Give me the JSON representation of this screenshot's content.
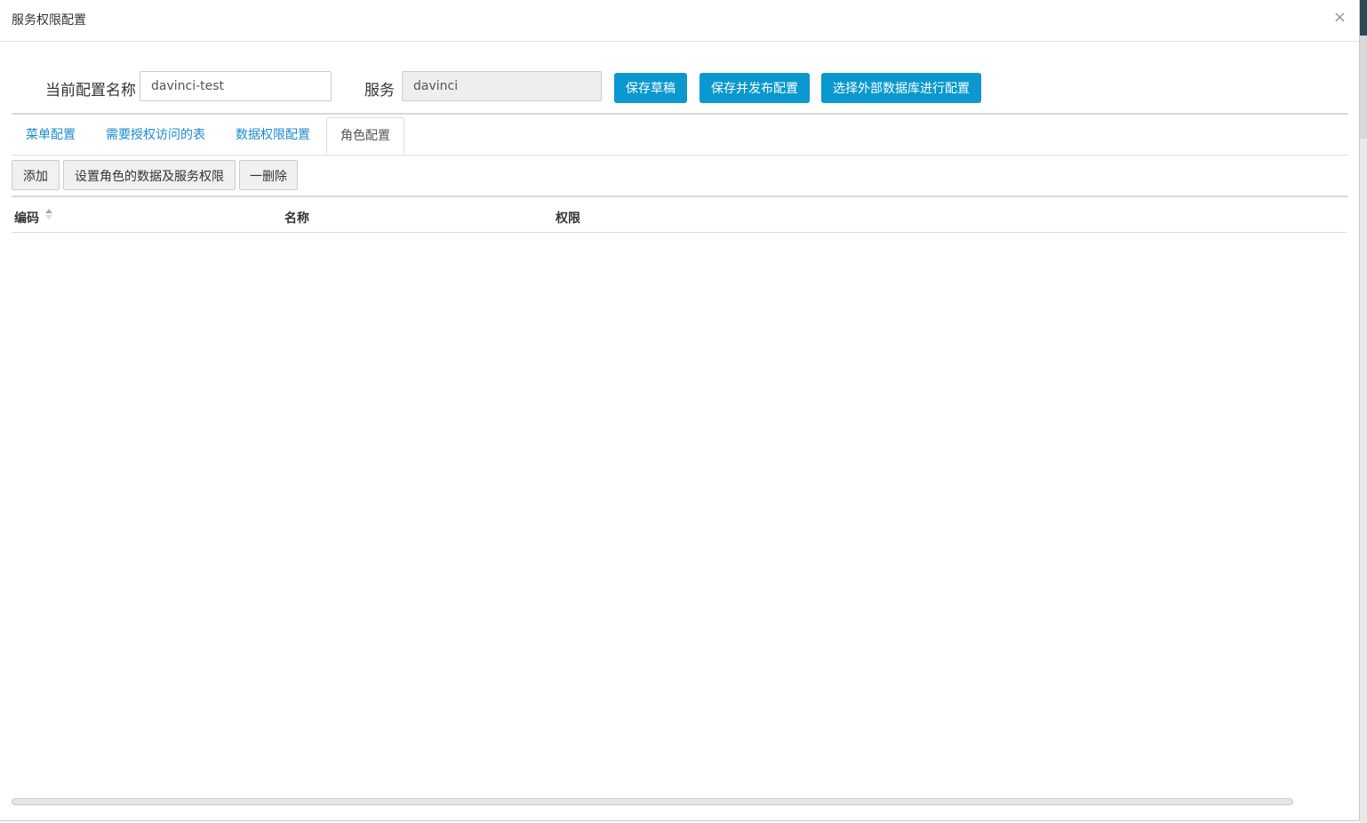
{
  "dialog": {
    "title": "服务权限配置",
    "close_symbol": "×"
  },
  "form": {
    "config_name_label": "当前配置名称",
    "config_name_value": "davinci-test",
    "service_label": "服务",
    "service_value": "davinci"
  },
  "actions": {
    "save_draft": "保存草稿",
    "save_publish": "保存并发布配置",
    "external_db": "选择外部数据库进行配置"
  },
  "tabs": [
    {
      "label": "菜单配置",
      "active": false
    },
    {
      "label": "需要授权访问的表",
      "active": false
    },
    {
      "label": "数据权限配置",
      "active": false
    },
    {
      "label": "角色配置",
      "active": true
    }
  ],
  "toolbar": {
    "add": "添加",
    "set_permissions": "设置角色的数据及服务权限",
    "delete": "一删除"
  },
  "table": {
    "columns": [
      "编码",
      "名称",
      "权限"
    ],
    "rows": []
  },
  "colors": {
    "primary": "#0a98ce",
    "tab_link": "#1b8bd0"
  }
}
